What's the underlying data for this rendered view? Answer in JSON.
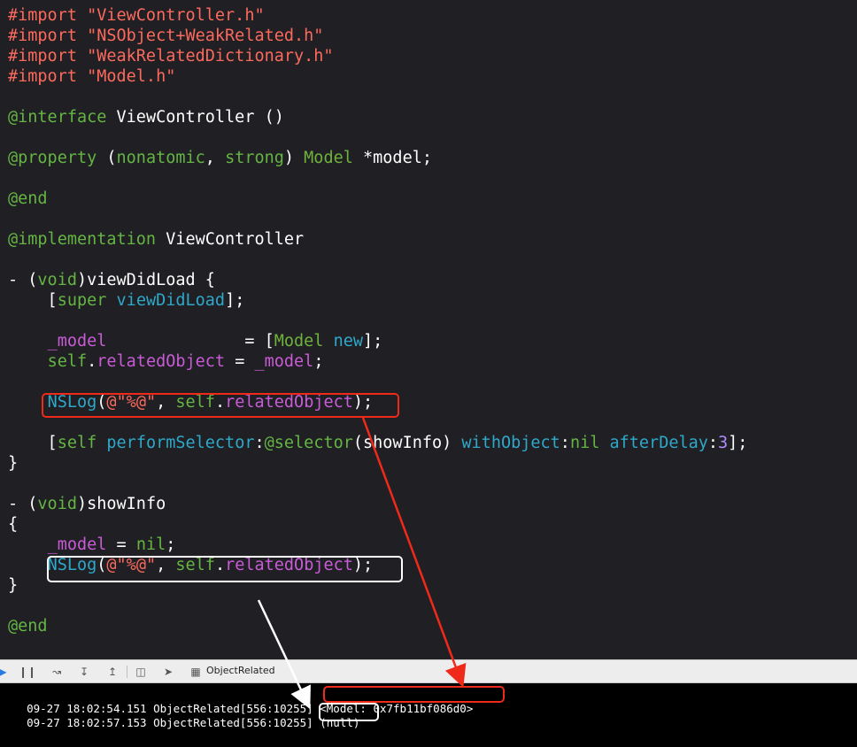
{
  "code_lines": [
    [
      {
        "t": "#import ",
        "c": "directive"
      },
      {
        "t": "\"ViewController.h\"",
        "c": "string"
      }
    ],
    [
      {
        "t": "#import ",
        "c": "directive"
      },
      {
        "t": "\"NSObject+WeakRelated.h\"",
        "c": "string"
      }
    ],
    [
      {
        "t": "#import ",
        "c": "directive"
      },
      {
        "t": "\"WeakRelatedDictionary.h\"",
        "c": "string"
      }
    ],
    [
      {
        "t": "#import ",
        "c": "directive"
      },
      {
        "t": "\"Model.h\"",
        "c": "string"
      }
    ],
    [],
    [
      {
        "t": "@interface ",
        "c": "keyword"
      },
      {
        "t": "ViewController ()",
        "c": "plain"
      }
    ],
    [],
    [
      {
        "t": "@property ",
        "c": "keyword"
      },
      {
        "t": "(",
        "c": "plain"
      },
      {
        "t": "nonatomic",
        "c": "keyword"
      },
      {
        "t": ", ",
        "c": "plain"
      },
      {
        "t": "strong",
        "c": "keyword"
      },
      {
        "t": ") ",
        "c": "plain"
      },
      {
        "t": "Model",
        "c": "class"
      },
      {
        "t": " *model;",
        "c": "plain"
      }
    ],
    [],
    [
      {
        "t": "@end",
        "c": "keyword"
      }
    ],
    [],
    [
      {
        "t": "@implementation ",
        "c": "keyword"
      },
      {
        "t": "ViewController",
        "c": "plain"
      }
    ],
    [],
    [
      {
        "t": "- (",
        "c": "plain"
      },
      {
        "t": "void",
        "c": "keyword"
      },
      {
        "t": ")viewDidLoad {",
        "c": "plain"
      }
    ],
    [
      {
        "t": "    [",
        "c": "plain"
      },
      {
        "t": "super",
        "c": "keyword"
      },
      {
        "t": " ",
        "c": "plain"
      },
      {
        "t": "viewDidLoad",
        "c": "method"
      },
      {
        "t": "];",
        "c": "plain"
      }
    ],
    [],
    [
      {
        "t": "    ",
        "c": "plain"
      },
      {
        "t": "_model",
        "c": "ivar"
      },
      {
        "t": "              = [",
        "c": "plain"
      },
      {
        "t": "Model",
        "c": "class"
      },
      {
        "t": " ",
        "c": "plain"
      },
      {
        "t": "new",
        "c": "method"
      },
      {
        "t": "];",
        "c": "plain"
      }
    ],
    [
      {
        "t": "    ",
        "c": "plain"
      },
      {
        "t": "self",
        "c": "keyword"
      },
      {
        "t": ".",
        "c": "plain"
      },
      {
        "t": "relatedObject",
        "c": "ivar"
      },
      {
        "t": " = ",
        "c": "plain"
      },
      {
        "t": "_model",
        "c": "ivar"
      },
      {
        "t": ";",
        "c": "plain"
      }
    ],
    [],
    [
      {
        "t": "    ",
        "c": "plain"
      },
      {
        "t": "NSLog",
        "c": "method"
      },
      {
        "t": "(",
        "c": "plain"
      },
      {
        "t": "@\"%@\"",
        "c": "string"
      },
      {
        "t": ", ",
        "c": "plain"
      },
      {
        "t": "self",
        "c": "keyword"
      },
      {
        "t": ".",
        "c": "plain"
      },
      {
        "t": "relatedObject",
        "c": "ivar"
      },
      {
        "t": ");",
        "c": "plain"
      }
    ],
    [],
    [
      {
        "t": "    [",
        "c": "plain"
      },
      {
        "t": "self",
        "c": "keyword"
      },
      {
        "t": " ",
        "c": "plain"
      },
      {
        "t": "performSelector",
        "c": "method"
      },
      {
        "t": ":",
        "c": "plain"
      },
      {
        "t": "@selector",
        "c": "keyword"
      },
      {
        "t": "(showInfo) ",
        "c": "plain"
      },
      {
        "t": "withObject",
        "c": "method"
      },
      {
        "t": ":",
        "c": "plain"
      },
      {
        "t": "nil",
        "c": "keyword"
      },
      {
        "t": " ",
        "c": "plain"
      },
      {
        "t": "afterDelay",
        "c": "method"
      },
      {
        "t": ":",
        "c": "plain"
      },
      {
        "t": "3",
        "c": "num"
      },
      {
        "t": "];",
        "c": "plain"
      }
    ],
    [
      {
        "t": "}",
        "c": "plain"
      }
    ],
    [],
    [
      {
        "t": "- (",
        "c": "plain"
      },
      {
        "t": "void",
        "c": "keyword"
      },
      {
        "t": ")showInfo",
        "c": "plain"
      }
    ],
    [
      {
        "t": "{",
        "c": "plain"
      }
    ],
    [
      {
        "t": "    ",
        "c": "plain"
      },
      {
        "t": "_model",
        "c": "ivar"
      },
      {
        "t": " = ",
        "c": "plain"
      },
      {
        "t": "nil",
        "c": "keyword"
      },
      {
        "t": ";",
        "c": "plain"
      }
    ],
    [
      {
        "t": "    ",
        "c": "plain"
      },
      {
        "t": "NSLog",
        "c": "method"
      },
      {
        "t": "(",
        "c": "plain"
      },
      {
        "t": "@\"%@\"",
        "c": "string"
      },
      {
        "t": ", ",
        "c": "plain"
      },
      {
        "t": "self",
        "c": "keyword"
      },
      {
        "t": ".",
        "c": "plain"
      },
      {
        "t": "relatedObject",
        "c": "ivar"
      },
      {
        "t": ");",
        "c": "plain"
      }
    ],
    [
      {
        "t": "}",
        "c": "plain"
      }
    ],
    [],
    [
      {
        "t": "@end",
        "c": "keyword"
      }
    ]
  ],
  "toolbar": {
    "target_label": "ObjectRelated",
    "icons": [
      "continue-icon",
      "pause-icon",
      "step-over-icon",
      "step-into-icon",
      "step-out-icon",
      "view-hierarchy-icon",
      "location-icon",
      "target-icon"
    ]
  },
  "console": {
    "line1_prefix": "09-27 18:02:54.151 ObjectRelated[556:10255] ",
    "line1_value": "<Model: 0x7fb11bf086d0>",
    "line2_prefix": "09-27 18:02:57.153 ObjectRelated[556:10255] ",
    "line2_value": "(null)"
  },
  "colors": {
    "editor_bg": "#1f1f24",
    "annotation_red": "#ef2a1a",
    "annotation_white": "#ffffff"
  }
}
